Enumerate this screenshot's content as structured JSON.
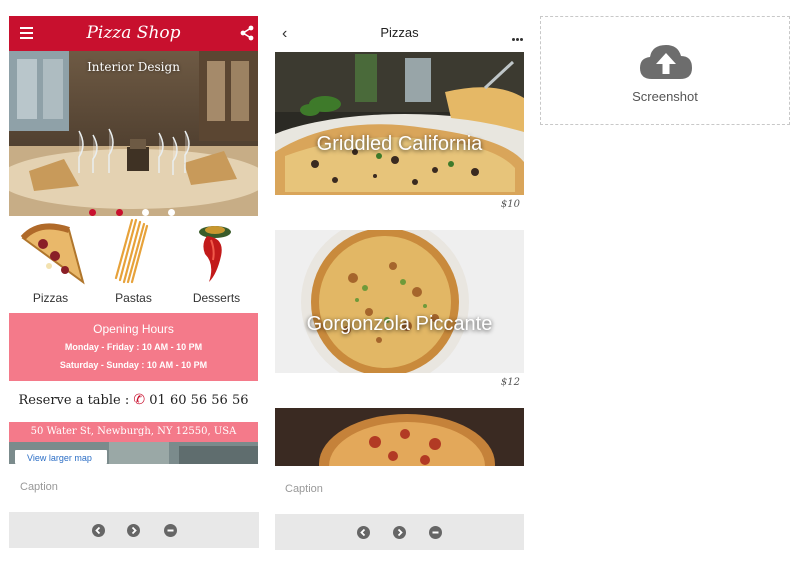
{
  "card1": {
    "brand": "Pizza Shop",
    "hero_caption": "Interior Design",
    "categories": [
      {
        "label": "Pizzas",
        "icon": "pizza-slice-icon"
      },
      {
        "label": "Pastas",
        "icon": "pasta-icon"
      },
      {
        "label": "Desserts",
        "icon": "pepper-icon"
      }
    ],
    "hours": {
      "title": "Opening Hours",
      "row1": "Monday   -   Friday : 10 AM - 10 PM",
      "row2": "Saturday - Sunday : 10 AM - 10 PM"
    },
    "reserve_label": "Reserve a table :",
    "phone": "01 60 56 56 56",
    "address": "50 Water St, Newburgh, NY 12550, USA",
    "map_link": "View larger map",
    "caption": "Caption",
    "carousel_active_index": 1
  },
  "card2": {
    "title": "Pizzas",
    "items": [
      {
        "name": "Griddled California",
        "price": "$10"
      },
      {
        "name": "Gorgonzola Piccante",
        "price": "$12"
      }
    ],
    "caption": "Caption"
  },
  "upload": {
    "label": "Screenshot",
    "icon": "cloud-upload-icon"
  },
  "colors": {
    "brand_red": "#c8102e",
    "accent_pink": "#f47a8a",
    "toolbar_grey": "#e8e8e8"
  }
}
